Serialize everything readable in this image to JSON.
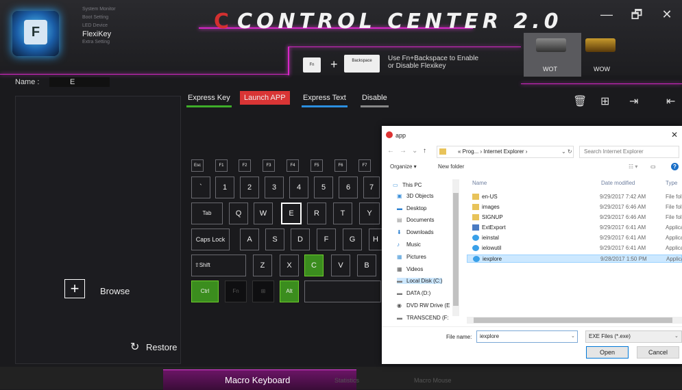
{
  "window": {
    "title": "CONTROL CENTER 2.0",
    "controls": {
      "minimize": "—",
      "restore": "🗗",
      "close": "✕"
    }
  },
  "side_menu": [
    "System Monitor",
    "Boot Setting",
    "LED Device",
    "FlexiKey",
    "Extra Setting"
  ],
  "app_icon_key": "F",
  "name": {
    "label": "Name :",
    "value": "E"
  },
  "hint": {
    "fn": "Fn",
    "plus": "+",
    "backspace": "Backspace",
    "text_line1": "Use Fn+Backspace to Enable",
    "text_line2": "or Disable Flexikey"
  },
  "games": [
    {
      "label": "WOT"
    },
    {
      "label": "WOW"
    }
  ],
  "tabs": [
    {
      "label": "Express Key",
      "color": "#3fae2a"
    },
    {
      "label": "Launch APP",
      "color": "#e23b3b"
    },
    {
      "label": "Express Text",
      "color": "#2b8fe0"
    },
    {
      "label": "Disable",
      "color": "#888888"
    }
  ],
  "left_panel": {
    "browse_label": "Browse",
    "restore_label": "Restore"
  },
  "keyboard": {
    "fn_row": [
      "Esc",
      "F1",
      "F2",
      "F3",
      "F4",
      "F5",
      "F6",
      "F7"
    ],
    "num_row": [
      "`",
      "1",
      "2",
      "3",
      "4",
      "5",
      "6",
      "7"
    ],
    "q_row": [
      "Tab",
      "Q",
      "W",
      "E",
      "R",
      "T",
      "Y"
    ],
    "a_row": [
      "Caps Lock",
      "A",
      "S",
      "D",
      "F",
      "G",
      "H"
    ],
    "z_row": [
      "⇧Shift",
      "Z",
      "X",
      "C",
      "V",
      "B"
    ],
    "ctrl_row": [
      "Ctrl",
      "Fn",
      "⊞",
      "Alt"
    ]
  },
  "bottom_tabs": [
    "Macro Keyboard",
    "Statistics",
    "Macro Mouse"
  ],
  "dialog": {
    "title": "app",
    "address": "« Prog... › Internet Explorer ›",
    "search_placeholder": "Search Internet Explorer",
    "organize": "Organize ▾",
    "new_folder": "New folder",
    "columns": {
      "name": "Name",
      "date": "Date modified",
      "type": "Type"
    },
    "tree": [
      "This PC",
      "3D Objects",
      "Desktop",
      "Documents",
      "Downloads",
      "Music",
      "Pictures",
      "Videos",
      "Local Disk (C:)",
      "DATA (D:)",
      "DVD RW Drive (E",
      "TRANSCEND (F:"
    ],
    "files": [
      {
        "name": "en-US",
        "date": "9/29/2017 7:42 AM",
        "type": "File fol",
        "kind": "folder"
      },
      {
        "name": "images",
        "date": "9/29/2017 6:46 AM",
        "type": "File fol",
        "kind": "folder"
      },
      {
        "name": "SIGNUP",
        "date": "9/29/2017 6:46 AM",
        "type": "File fol",
        "kind": "folder"
      },
      {
        "name": "ExtExport",
        "date": "9/29/2017 6:41 AM",
        "type": "Applica",
        "kind": "app"
      },
      {
        "name": "ieinstal",
        "date": "9/29/2017 6:41 AM",
        "type": "Applica",
        "kind": "ie"
      },
      {
        "name": "ielowutil",
        "date": "9/29/2017 6:41 AM",
        "type": "Applica",
        "kind": "ie"
      },
      {
        "name": "iexplore",
        "date": "9/28/2017 1:50 PM",
        "type": "Applica",
        "kind": "ie"
      }
    ],
    "file_name_label": "File name:",
    "file_name_value": "iexplore",
    "file_type": "EXE Files (*.exe)",
    "open": "Open",
    "cancel": "Cancel"
  }
}
